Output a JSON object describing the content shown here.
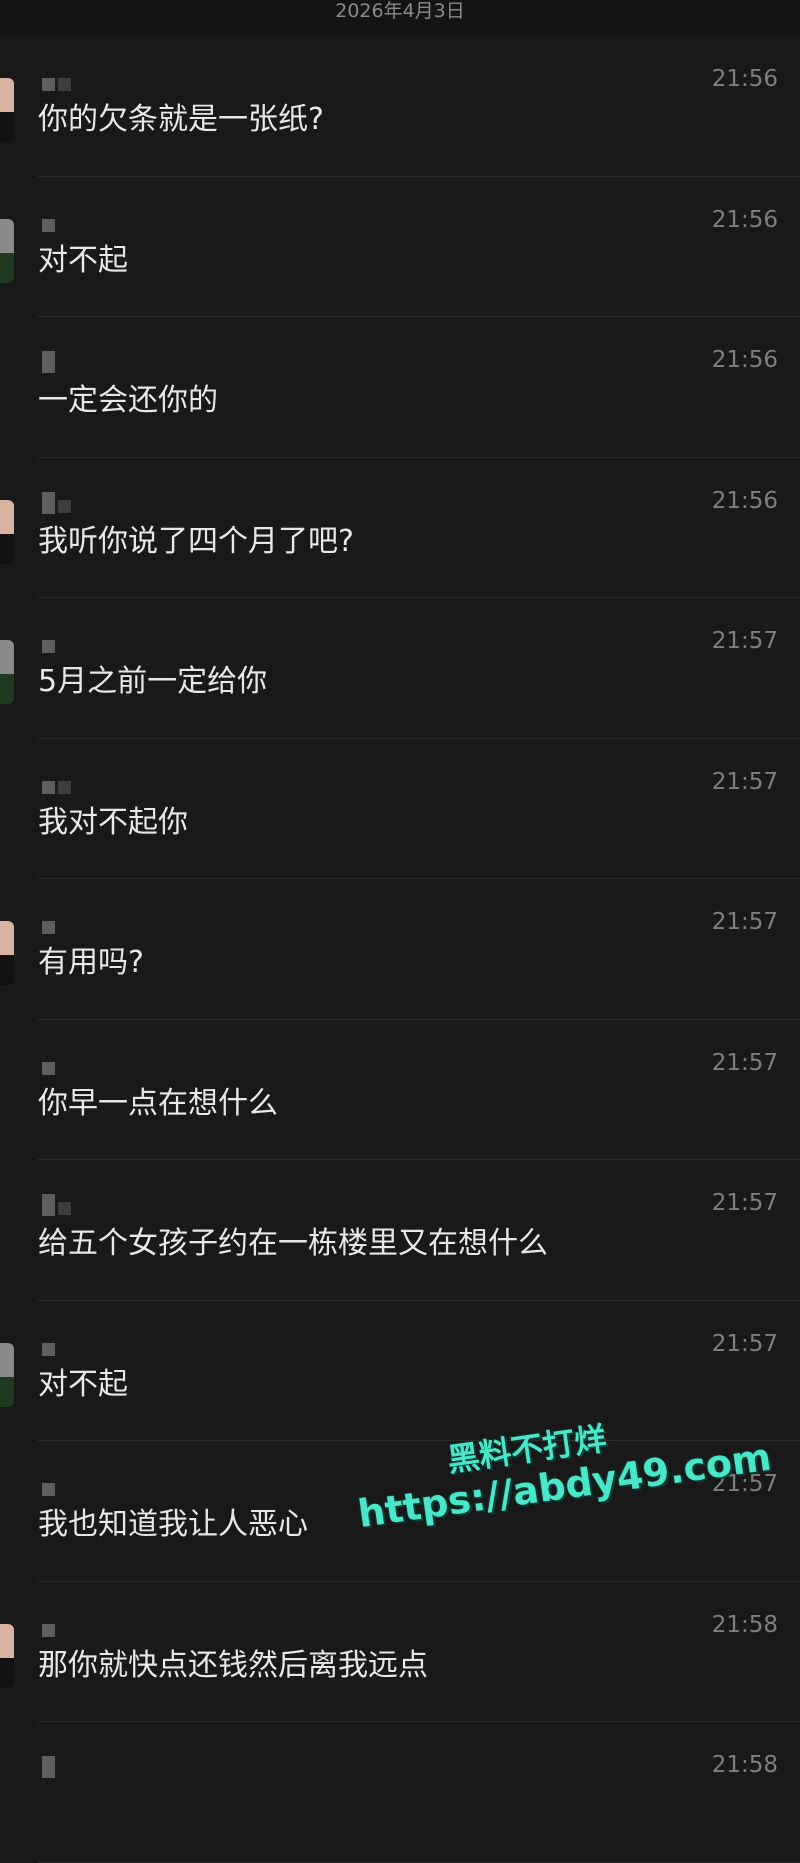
{
  "header": {
    "date": "2026年4月3日"
  },
  "messages": [
    {
      "time": "21:56",
      "text": "你的欠条就是一张纸?",
      "avatar": "a",
      "nick": "two"
    },
    {
      "time": "21:56",
      "text": "对不起",
      "avatar": "b",
      "nick": "one"
    },
    {
      "time": "21:56",
      "text": "一定会还你的",
      "avatar": "none",
      "nick": "tall"
    },
    {
      "time": "21:56",
      "text": "我听你说了四个月了吧?",
      "avatar": "a",
      "nick": "pair"
    },
    {
      "time": "21:57",
      "text": "5月之前一定给你",
      "avatar": "b",
      "nick": "one"
    },
    {
      "time": "21:57",
      "text": "我对不起你",
      "avatar": "none",
      "nick": "two"
    },
    {
      "time": "21:57",
      "text": "有用吗?",
      "avatar": "a",
      "nick": "one"
    },
    {
      "time": "21:57",
      "text": "你早一点在想什么",
      "avatar": "none",
      "nick": "one"
    },
    {
      "time": "21:57",
      "text": "给五个女孩子约在一栋楼里又在想什么",
      "avatar": "none",
      "nick": "pair"
    },
    {
      "time": "21:57",
      "text": "对不起",
      "avatar": "b",
      "nick": "one"
    },
    {
      "time": "21:57",
      "text": "我也知道我让人恶心",
      "avatar": "none",
      "nick": "one"
    },
    {
      "time": "21:58",
      "text": "那你就快点还钱然后离我远点",
      "avatar": "a",
      "nick": "one"
    },
    {
      "time": "21:58",
      "text": "",
      "avatar": "none",
      "nick": "tall"
    }
  ],
  "watermark": {
    "line1": "黑料不打烊",
    "line2": "https://abdy49.com"
  },
  "colors": {
    "background": "#191919",
    "text": "#e8e8e8",
    "time": "#7f7f7f",
    "watermark": "#49e6c9"
  }
}
